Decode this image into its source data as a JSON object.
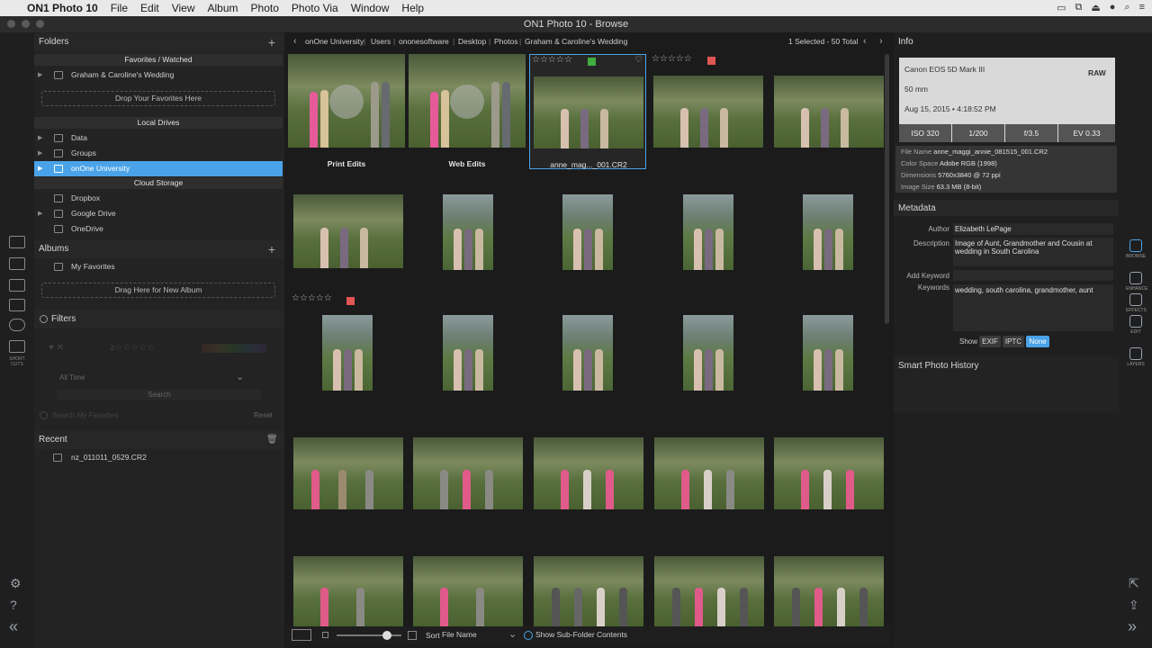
{
  "menubar": {
    "app_name": "ON1 Photo 10",
    "items": [
      "File",
      "Edit",
      "View",
      "Album",
      "Photo",
      "Photo Via",
      "Window",
      "Help"
    ]
  },
  "window": {
    "title": "ON1 Photo 10 - Browse"
  },
  "folders_panel": {
    "title": "Folders",
    "favorites_header": "Favorites / Watched",
    "favorite_item": "Graham & Caroline's Wedding",
    "drop_favorites": "Drop Your Favorites Here",
    "local_drives_header": "Local Drives",
    "local_drives": [
      "Data",
      "Groups",
      "onOne University"
    ],
    "cloud_header": "Cloud Storage",
    "cloud_items": [
      "Dropbox",
      "Google Drive",
      "OneDrive"
    ]
  },
  "albums_panel": {
    "title": "Albums",
    "item": "My Favorites",
    "drop_album": "Drag Here for New Album"
  },
  "filters_panel": {
    "title": "Filters",
    "time": "All Time",
    "search_placeholder": "Search",
    "search_favorites": "Search My Favorites",
    "reset": "Reset"
  },
  "recent_panel": {
    "title": "Recent",
    "item": "nz_011011_0529.CR2"
  },
  "path": {
    "crumbs": [
      "onOne University",
      "Users",
      "ononesoftware",
      "Desktop",
      "Photos",
      "Graham & Caroline's Wedding"
    ],
    "status": "1 Selected - 50 Total"
  },
  "grid": {
    "captions": [
      "Print Edits",
      "Web Edits",
      "anne_mag..._001.CR2"
    ],
    "stars": "☆☆☆☆☆"
  },
  "bottombar": {
    "sort_label": "Sort",
    "sort_value": "File Name",
    "subfolder": "Show Sub-Folder Contents"
  },
  "info": {
    "title": "Info",
    "camera": "Canon EOS 5D Mark III",
    "format": "RAW",
    "lens": "50 mm",
    "date": "Aug 15, 2015 • 4:18:52 PM",
    "exposure": [
      "ISO 320",
      "1/200",
      "f/3.5",
      "EV 0.33"
    ],
    "file_name_label": "File Name",
    "file_name": "anne_maggi_annie_081515_001.CR2",
    "color_space_label": "Color Space",
    "color_space": "Adobe RGB (1998)",
    "dimensions_label": "Dimensions",
    "dimensions": "5760x3840 @ 72 ppi",
    "image_size_label": "Image Size",
    "image_size": "63.3 MB (8-bit)"
  },
  "metadata": {
    "title": "Metadata",
    "author_label": "Author",
    "author": "Elizabeth LePage",
    "description_label": "Description",
    "description": "Image of Aunt, Grandmother and Cousin at wedding in South Carolina",
    "add_keyword_label": "Add Keyword",
    "keywords_label": "Keywords",
    "keywords": "wedding, south carolina, grandmother, aunt",
    "show_label": "Show",
    "show_options": [
      "EXIF",
      "IPTC",
      "None"
    ]
  },
  "history": {
    "title": "Smart Photo History"
  },
  "right_tools": [
    "BROWSE",
    "ENHANCE",
    "EFFECTS",
    "EDIT",
    "LAYERS"
  ],
  "left_tools": [
    "SHORT CUTS"
  ]
}
